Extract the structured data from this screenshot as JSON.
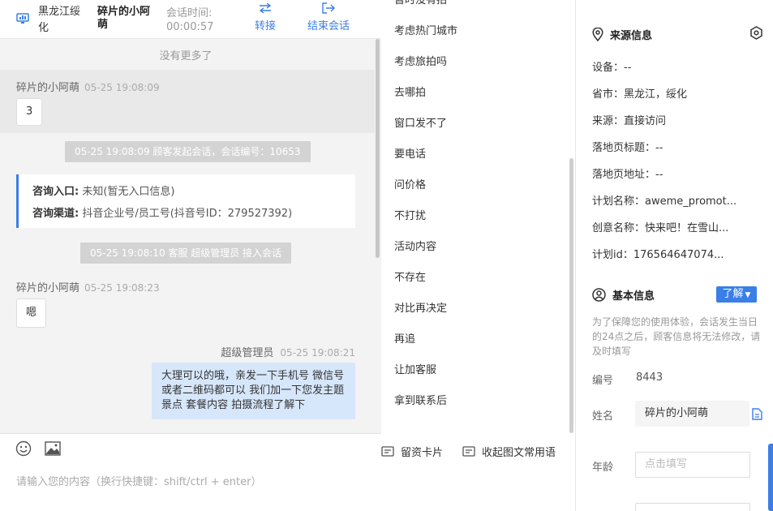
{
  "header": {
    "location": "黑龙江绥化",
    "customer_name": "碎片的小阿萌",
    "session_time_label": "会话时间:",
    "session_time_value": "00:00:57",
    "transfer_label": "转接",
    "end_label": "结束会话"
  },
  "chat": {
    "no_more": "没有更多了",
    "msg1_sender": "碎片的小阿萌",
    "msg1_time": "05-25 19:08:09",
    "msg1_text": "3",
    "sys1": "05-25 19:08:09 顾客发起会话，会话编号：10653",
    "card_entry_key": "咨询入口:",
    "card_entry_val": "未知(暂无入口信息)",
    "card_channel_key": "咨询渠道:",
    "card_channel_val": "抖音企业号/员工号(抖音号ID：279527392)",
    "sys2": "05-25 19:08:10 客服 超级管理员 接入会话",
    "msg2_sender": "碎片的小阿萌",
    "msg2_time": "05-25 19:08:23",
    "msg2_text": "嗯",
    "msg3_sender": "超级管理员",
    "msg3_time": "05-25 19:08:21",
    "msg3_text": "大理可以的哦，亲发一下手机号 微信号或者二维码都可以 我们加一下您发主题景点 套餐内容 拍摄流程了解下"
  },
  "input": {
    "placeholder": "请输入您的内容（换行快捷键：shift/ctrl + enter）",
    "card_label": "留资卡片",
    "phrases_label": "收起图文常用语"
  },
  "phrases": [
    "暂时没有拍",
    "考虑热门城市",
    "考虑旅拍吗",
    "去哪拍",
    "窗口发不了",
    "要电话",
    "问价格",
    "不打扰",
    "活动内容",
    "不存在",
    "对比再决定",
    "再追",
    "让加客服",
    "拿到联系后"
  ],
  "source_info": {
    "title": "来源信息",
    "device": "设备：--",
    "province": "省市：黑龙江，绥化",
    "source": "来源：直接访问",
    "landing_title": "落地页标题：--",
    "landing_url": "落地页地址：--",
    "plan_name": "计划名称：aweme_promot...",
    "creative_name": "创意名称：快来吧！在雪山...",
    "plan_id": "计划id：176564647074..."
  },
  "basic_info": {
    "title": "基本信息",
    "learn_label": "了解",
    "notice": "为了保障您的使用体验，会话发生当日的24点之后，顾客信息将无法修改，请及时填写",
    "id_label": "编号",
    "id_value": "8443",
    "name_label": "姓名",
    "name_value": "碎片的小阿萌",
    "age_label": "年龄",
    "age_placeholder": "点击填写"
  },
  "colors": {
    "accent": "#3a7ee8",
    "bubble_self": "#d7e7fb",
    "system_tag": "#d3d3d3"
  }
}
